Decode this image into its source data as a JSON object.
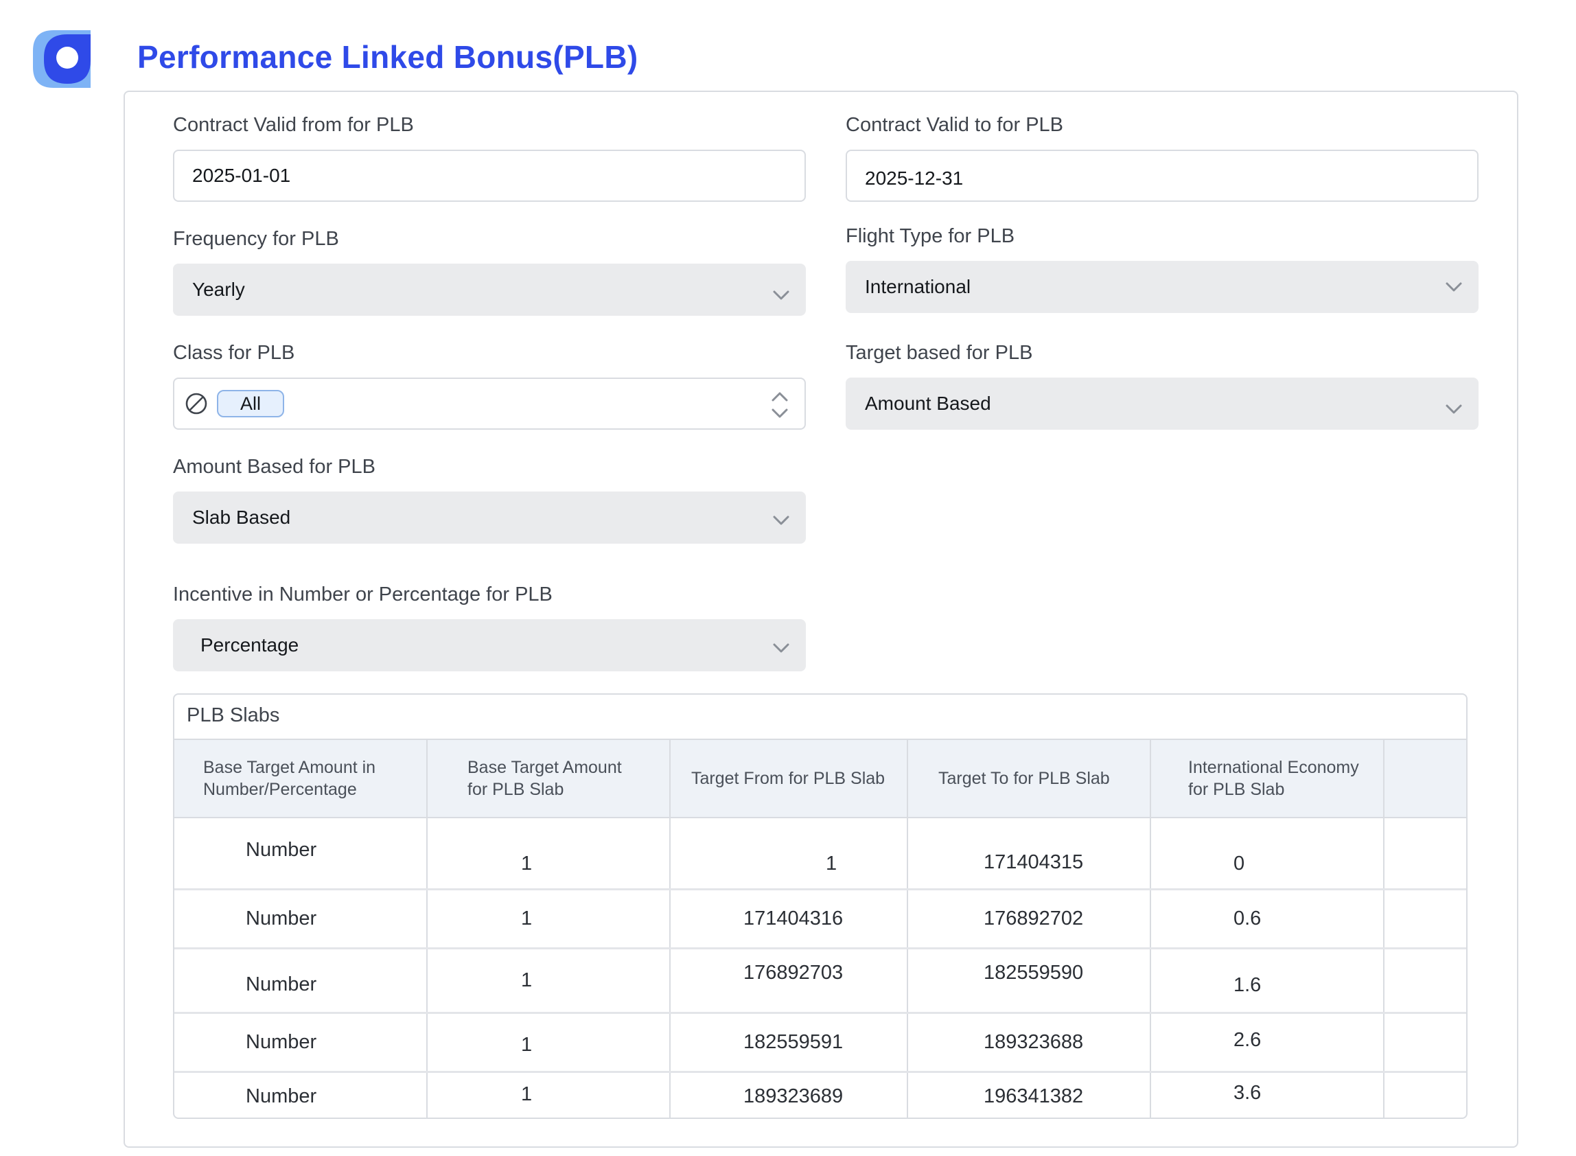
{
  "header": {
    "title": "Performance Linked Bonus(PLB)"
  },
  "form": {
    "valid_from": {
      "label": "Contract Valid from for PLB",
      "value": "2025-01-01"
    },
    "valid_to": {
      "label": "Contract Valid to for PLB",
      "value": "2025-12-31"
    },
    "frequency": {
      "label": "Frequency for PLB",
      "value": "Yearly"
    },
    "flight_type": {
      "label": "Flight Type for PLB",
      "value": "International"
    },
    "class": {
      "label": "Class for PLB",
      "chip": "All"
    },
    "target_based": {
      "label": "Target based for PLB",
      "value": "Amount Based"
    },
    "amount_based": {
      "label": "Amount Based for PLB",
      "value": "Slab Based"
    },
    "incentive": {
      "label": "Incentive in Number or Percentage for PLB",
      "value": "Percentage"
    }
  },
  "slabs": {
    "title": "PLB Slabs",
    "columns": [
      "Base Target Amount in Number/Percentage",
      "Base Target Amount for PLB Slab",
      "Target From for PLB Slab",
      "Target To for PLB Slab",
      "International Economy for PLB Slab",
      ""
    ],
    "rows": [
      [
        "Number",
        "1",
        "1",
        "171404315",
        "0"
      ],
      [
        "Number",
        "1",
        "171404316",
        "176892702",
        "0.6"
      ],
      [
        "Number",
        "1",
        "176892703",
        "182559590",
        "1.6"
      ],
      [
        "Number",
        "1",
        "182559591",
        "189323688",
        "2.6"
      ],
      [
        "Number",
        "1",
        "189323689",
        "196341382",
        "3.6"
      ]
    ]
  }
}
